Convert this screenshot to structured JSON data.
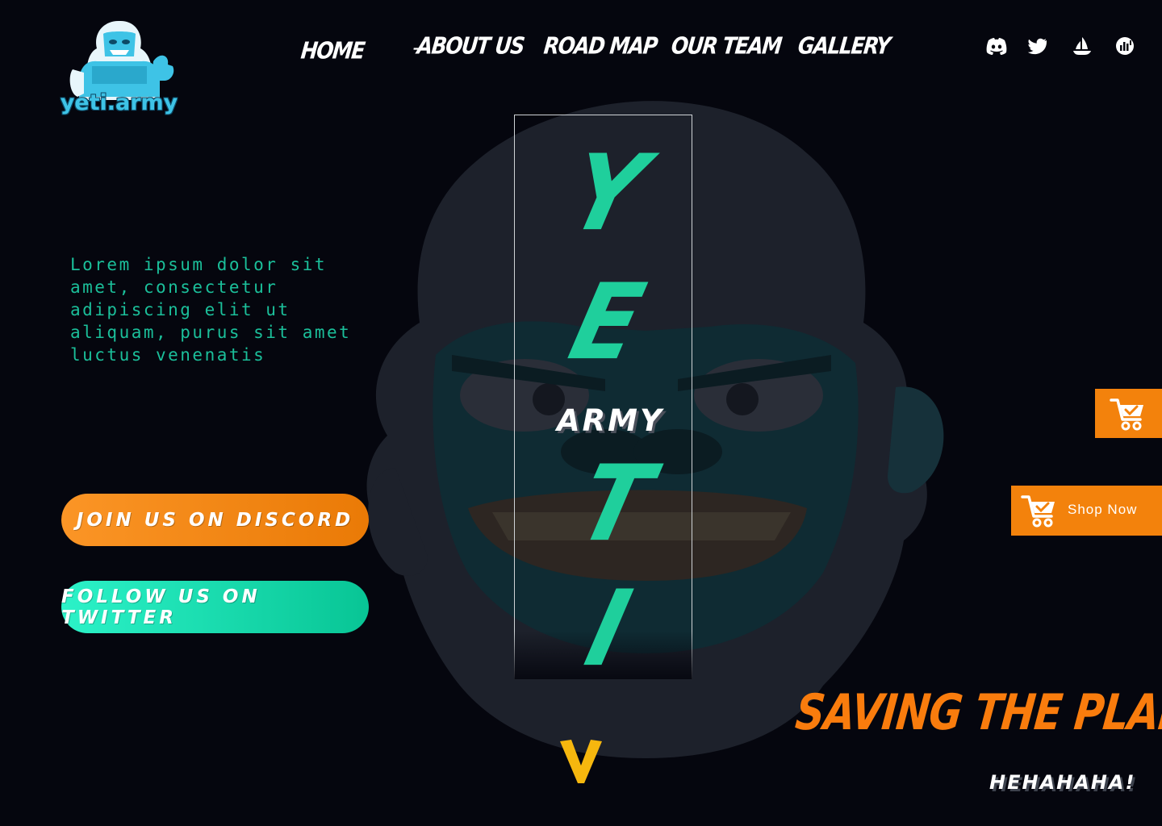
{
  "brand": {
    "logo_text": "yeti.army"
  },
  "nav": {
    "items": [
      {
        "label": "HOME"
      },
      {
        "label": "ABOUT US"
      },
      {
        "label": "ROAD MAP"
      },
      {
        "label": "OUR TEAM"
      },
      {
        "label": "GALLERY"
      }
    ]
  },
  "social": [
    "discord-icon",
    "twitter-icon",
    "opensea-icon",
    "stats-icon"
  ],
  "hero": {
    "intro": "Lorem ipsum dolor sit amet, consectetur adipiscing elit ut aliquam, purus sit amet luctus venenatis",
    "title_letters": [
      "Y",
      "E",
      "T",
      "I"
    ],
    "subtitle": "ARMY",
    "tagline": "SAVING THE PLANET",
    "laugh": "HEHAHAHA!"
  },
  "cta": {
    "discord_label": "JOIN US ON DISCORD",
    "twitter_label": "FOLLOW US ON TWITTER"
  },
  "shop": {
    "label": "Shop Now"
  },
  "colors": {
    "background": "#05060e",
    "accent_teal": "#1fcf9c",
    "accent_orange": "#f3820c",
    "arrow_yellow": "#f6b70e"
  }
}
